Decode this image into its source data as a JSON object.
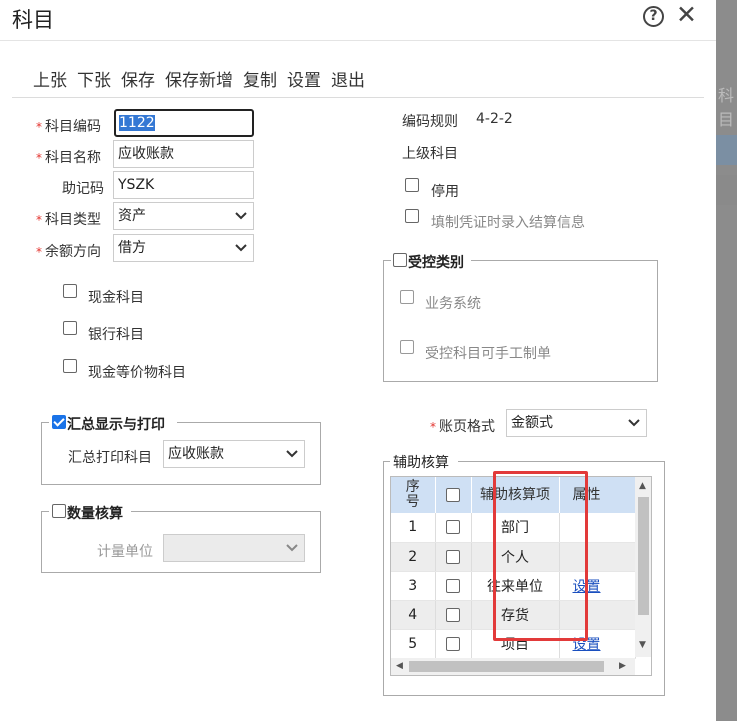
{
  "dialog": {
    "title": "科目",
    "help": "?",
    "close": "✕"
  },
  "backdrop": {
    "partial_text": "科目"
  },
  "toolbar": [
    "上张",
    "下张",
    "保存",
    "保存新增",
    "复制",
    "设置",
    "退出"
  ],
  "form": {
    "required_mark": "*",
    "code": {
      "label": "科目编码",
      "value": "1122"
    },
    "name": {
      "label": "科目名称",
      "value": "应收账款"
    },
    "mnemonic": {
      "label": "助记码",
      "value": "YSZK"
    },
    "type": {
      "label": "科目类型",
      "value": "资产"
    },
    "direction": {
      "label": "余额方向",
      "value": "借方"
    },
    "cash": {
      "label": "现金科目",
      "checked": false
    },
    "bank": {
      "label": "银行科目",
      "checked": false
    },
    "cash_equiv": {
      "label": "现金等价物科目",
      "checked": false
    },
    "rule": {
      "label": "编码规则",
      "value": "4-2-2"
    },
    "parent": {
      "label": "上级科目",
      "value": ""
    },
    "disabled": {
      "label": "停用",
      "checked": false
    },
    "voucher_settle": {
      "label": "填制凭证时录入结算信息",
      "checked": false
    }
  },
  "controlled": {
    "legend": "受控类别",
    "checked": false,
    "business": {
      "label": "业务系统",
      "checked": false
    },
    "manual": {
      "label": "受控科目可手工制单",
      "checked": false
    }
  },
  "summary": {
    "legend": "汇总显示与打印",
    "checked": true,
    "print_label": "汇总打印科目",
    "print_value": "应收账款"
  },
  "ledger": {
    "label": "账页格式",
    "value": "金额式"
  },
  "quantity": {
    "legend": "数量核算",
    "checked": false,
    "unit_label": "计量单位",
    "unit_value": ""
  },
  "aux": {
    "legend": "辅助核算",
    "headers": {
      "seq": "序号",
      "item": "辅助核算项",
      "attr": "属性"
    },
    "rows": [
      {
        "seq": "1",
        "item": "部门",
        "attr": ""
      },
      {
        "seq": "2",
        "item": "个人",
        "attr": ""
      },
      {
        "seq": "3",
        "item": "往来单位",
        "attr": "设置"
      },
      {
        "seq": "4",
        "item": "存货",
        "attr": ""
      },
      {
        "seq": "5",
        "item": "项目",
        "attr": "设置"
      }
    ]
  }
}
